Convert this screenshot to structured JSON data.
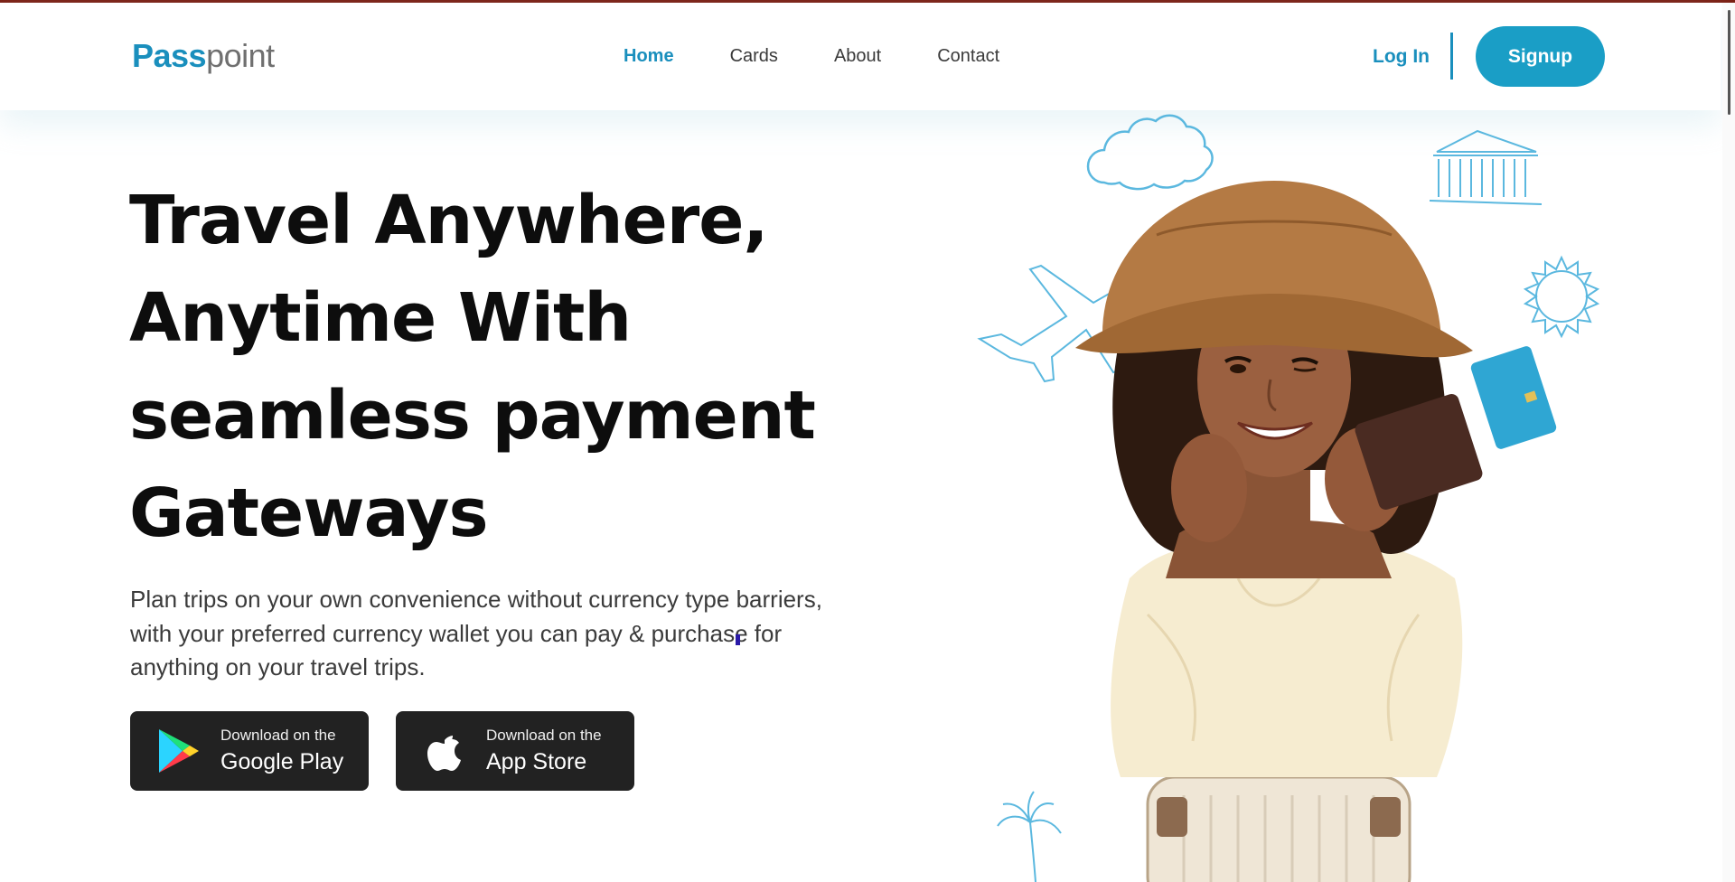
{
  "brand": {
    "logo_part1": "Pass",
    "logo_part2": "point"
  },
  "nav": {
    "items": [
      {
        "label": "Home",
        "active": true
      },
      {
        "label": "Cards",
        "active": false
      },
      {
        "label": "About",
        "active": false
      },
      {
        "label": "Contact",
        "active": false
      }
    ],
    "login_label": "Log In",
    "signup_label": "Signup"
  },
  "hero": {
    "title_lines": [
      "Travel Anywhere,",
      "Anytime With",
      "seamless payment",
      "Gateways"
    ],
    "description": "Plan trips on your own convenience without currency type barriers, with your preferred currency wallet you can pay & purchase for anything on your travel trips."
  },
  "downloads": {
    "google": {
      "small": "Download on the",
      "big": "Google Play",
      "icon": "google-play-icon"
    },
    "apple": {
      "small": "Download on the",
      "big": "App Store",
      "icon": "apple-icon"
    }
  },
  "colors": {
    "accent": "#1a8fbd",
    "signup_bg": "#1a9ec6",
    "store_button_bg": "#222222",
    "top_rule": "#7a1e12",
    "doodle_stroke": "#5bb8df"
  },
  "illustration": {
    "icons": [
      "cloud-icon",
      "museum-icon",
      "airplane-icon",
      "sun-icon",
      "palm-tree-icon",
      "card-icon"
    ]
  }
}
